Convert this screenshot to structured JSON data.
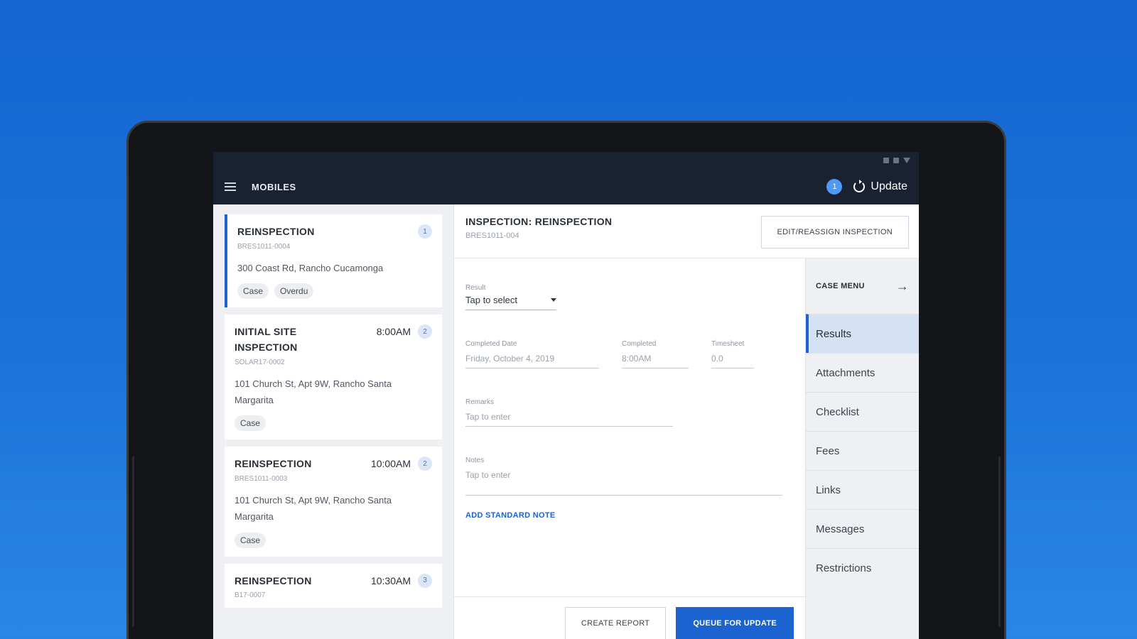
{
  "app": {
    "title": "MOBILES",
    "notification_count": "1",
    "update_label": "Update"
  },
  "inspection_list": [
    {
      "title": "REINSPECTION",
      "time": "",
      "count": "1",
      "id": "BRES1011-0004",
      "address": "300 Coast Rd, Rancho Cucamonga",
      "chips": [
        "Case",
        "Overdu"
      ]
    },
    {
      "title": "INITIAL SITE INSPECTION",
      "time": "8:00AM",
      "count": "2",
      "id": "SOLAR17-0002",
      "address": "101 Church St, Apt 9W, Rancho Santa Margarita",
      "chips": [
        "Case"
      ]
    },
    {
      "title": "REINSPECTION",
      "time": "10:00AM",
      "count": "2",
      "id": "BRES1011-0003",
      "address": "101 Church St, Apt 9W, Rancho Santa Margarita",
      "chips": [
        "Case"
      ]
    },
    {
      "title": "REINSPECTION",
      "time": "10:30AM",
      "count": "3",
      "id": "B17-0007",
      "address": "",
      "chips": []
    }
  ],
  "detail": {
    "title": "INSPECTION: REINSPECTION",
    "id": "BRES1011-004",
    "edit_button": "EDIT/REASSIGN INSPECTION",
    "result": {
      "label": "Result",
      "value": "Tap to select"
    },
    "completed_date": {
      "label": "Completed Date",
      "value": "Friday, October 4, 2019"
    },
    "completed_time": {
      "label": "Completed",
      "value": "8:00AM"
    },
    "timesheet": {
      "label": "Timesheet",
      "value": "0.0"
    },
    "remarks": {
      "label": "Remarks",
      "placeholder": "Tap to enter"
    },
    "notes": {
      "label": "Notes",
      "placeholder": "Tap to enter"
    },
    "add_standard_note": "ADD STANDARD NOTE",
    "create_report": "CREATE REPORT",
    "queue_for_update": "QUEUE FOR UPDATE"
  },
  "case_menu": {
    "title": "CASE MENU",
    "items": [
      "Results",
      "Attachments",
      "Checklist",
      "Fees",
      "Links",
      "Messages",
      "Restrictions"
    ],
    "active_index": 0
  },
  "colors": {
    "background": "#1a6fd6",
    "accent": "#1b63d0",
    "appbar": "#1a2130"
  }
}
